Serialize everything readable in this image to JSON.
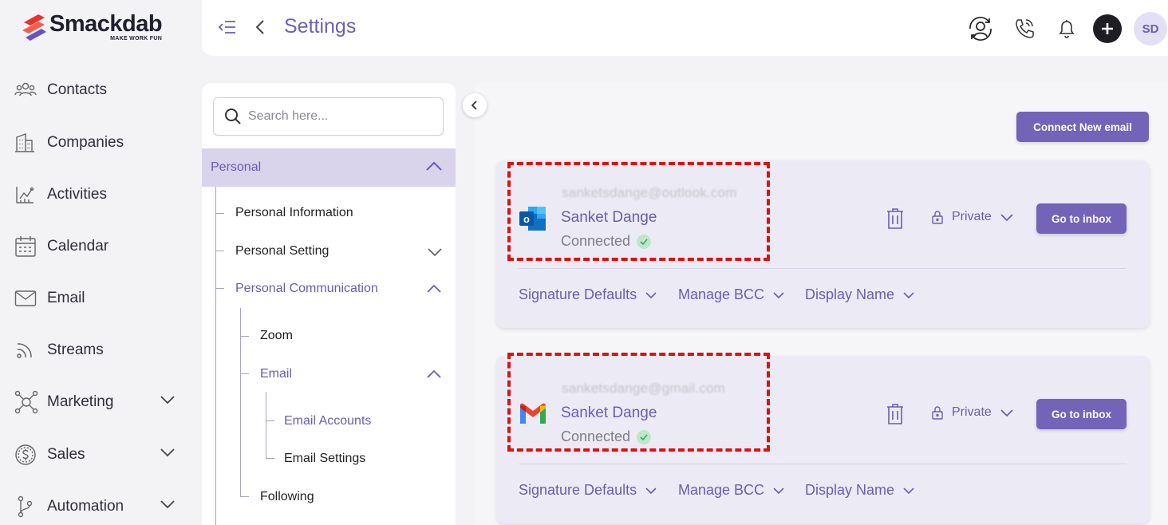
{
  "brand": {
    "name": "Smackdab",
    "tagline": "MAKE WORK FUN"
  },
  "nav": {
    "items": [
      {
        "label": "Contacts",
        "icon": "contacts-icon",
        "expandable": false
      },
      {
        "label": "Companies",
        "icon": "building-icon",
        "expandable": false
      },
      {
        "label": "Activities",
        "icon": "activities-icon",
        "expandable": false
      },
      {
        "label": "Calendar",
        "icon": "calendar-icon",
        "expandable": false
      },
      {
        "label": "Email",
        "icon": "envelope-icon",
        "expandable": false
      },
      {
        "label": "Streams",
        "icon": "streams-icon",
        "expandable": false
      },
      {
        "label": "Marketing",
        "icon": "marketing-icon",
        "expandable": true
      },
      {
        "label": "Sales",
        "icon": "dollar-icon",
        "expandable": true
      },
      {
        "label": "Automation",
        "icon": "automation-icon",
        "expandable": true
      }
    ]
  },
  "header": {
    "title": "Settings",
    "avatar_initials": "SD"
  },
  "settings_tree": {
    "search_placeholder": "Search here...",
    "section": "Personal",
    "items": {
      "personal_information": "Personal Information",
      "personal_setting": "Personal Setting",
      "personal_communication": "Personal Communication",
      "zoom": "Zoom",
      "email": "Email",
      "email_accounts": "Email Accounts",
      "email_settings": "Email Settings",
      "following": "Following"
    }
  },
  "main": {
    "connect_button": "Connect New email",
    "accounts": [
      {
        "provider": "outlook",
        "email": "sanketsdange@outlook.com",
        "name": "Sanket Dange",
        "status": "Connected",
        "privacy": "Private",
        "inbox_button": "Go to inbox",
        "options": [
          "Signature Defaults",
          "Manage BCC",
          "Display Name"
        ]
      },
      {
        "provider": "gmail",
        "email": "sanketsdange@gmail.com",
        "name": "Sanket Dange",
        "status": "Connected",
        "privacy": "Private",
        "inbox_button": "Go to inbox",
        "options": [
          "Signature Defaults",
          "Manage BCC",
          "Display Name"
        ]
      }
    ]
  },
  "colors": {
    "accent": "#6a5cb3",
    "button": "#7363b9",
    "section_highlight": "#d9d4ec",
    "annotation": "#e01010"
  }
}
